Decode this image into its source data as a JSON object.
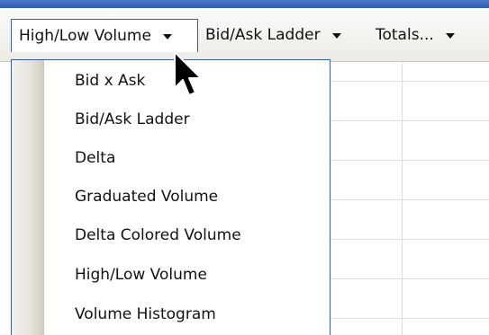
{
  "toolbar": {
    "buttons": [
      {
        "label": "High/Low Volume"
      },
      {
        "label": "Bid/Ask Ladder"
      },
      {
        "label": "Totals..."
      }
    ]
  },
  "menu": {
    "items": [
      {
        "label": "Bid x Ask"
      },
      {
        "label": "Bid/Ask Ladder"
      },
      {
        "label": "Delta"
      },
      {
        "label": "Graduated Volume"
      },
      {
        "label": "Delta Colored Volume"
      },
      {
        "label": "High/Low Volume"
      },
      {
        "label": "Volume Histogram"
      }
    ]
  },
  "colors": {
    "title_bar": "#2f5bb0",
    "menu_border": "#3b5e9e"
  },
  "icons": {
    "dropdown": "chevron-down-icon",
    "pointer": "mouse-cursor-icon"
  }
}
